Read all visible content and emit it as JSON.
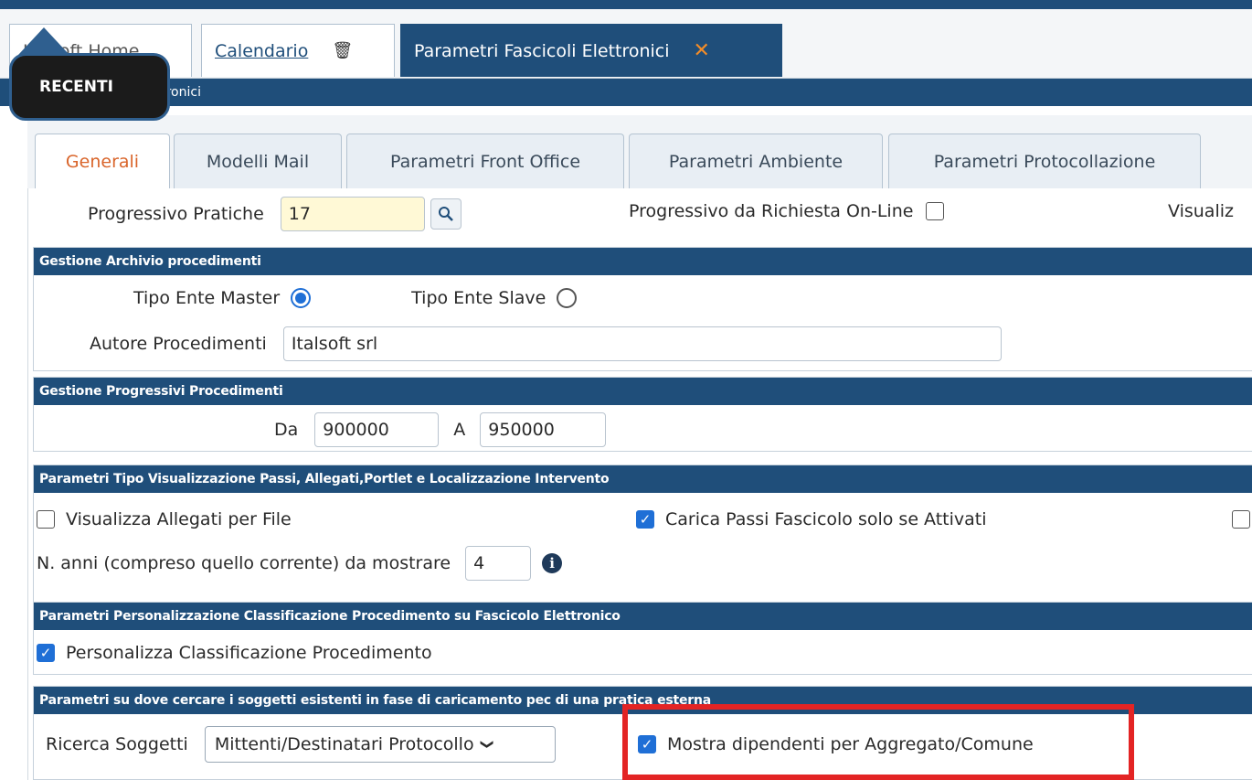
{
  "window_tabs": {
    "home": "Italsoft Home",
    "calendar": "Calendario",
    "active": "Parametri Fascicoli Elettronici"
  },
  "breadcrumb": "Parametri Fascicoli Elettronici",
  "recenti_label": "RECENTI",
  "subtabs": [
    "Generali",
    "Modelli Mail",
    "Parametri Front Office",
    "Parametri Ambiente",
    "Parametri Protocollazione"
  ],
  "progressivo": {
    "label": "Progressivo Pratiche",
    "value": "17",
    "online_label": "Progressivo da Richiesta On-Line",
    "right_label": "Visualiz"
  },
  "archivio": {
    "title": "Gestione Archivio procedimenti",
    "master_label": "Tipo Ente Master",
    "slave_label": "Tipo Ente Slave",
    "autore_label": "Autore Procedimenti",
    "autore_value": "Italsoft srl"
  },
  "progressivi": {
    "title": "Gestione Progressivi Procedimenti",
    "da_label": "Da",
    "da_value": "900000",
    "a_label": "A",
    "a_value": "950000"
  },
  "visualizzazione": {
    "title": "Parametri Tipo Visualizzazione Passi, Allegati,Portlet e Localizzazione Intervento",
    "allegati_label": "Visualizza Allegati per File",
    "carica_label": "Carica Passi Fascicolo solo se Attivati",
    "anni_label": "N. anni (compreso quello corrente) da mostrare",
    "anni_value": "4"
  },
  "classificazione": {
    "title": "Parametri Personalizzazione Classificazione Procedimento su Fascicolo Elettronico",
    "personalizza_label": "Personalizza Classificazione Procedimento"
  },
  "soggetti": {
    "title": "Parametri su dove cercare i soggetti esistenti in fase di caricamento pec di una pratica esterna",
    "ricerca_label": "Ricerca Soggetti",
    "ricerca_value": "Mittenti/Destinatari Protocollo",
    "mostra_label": "Mostra dipendenti per Aggregato/Comune"
  },
  "colors": {
    "header": "#1f4e7a",
    "accent_tab": "#d9652b",
    "checkbox": "#1f6fd6",
    "highlight": "#e32424"
  }
}
